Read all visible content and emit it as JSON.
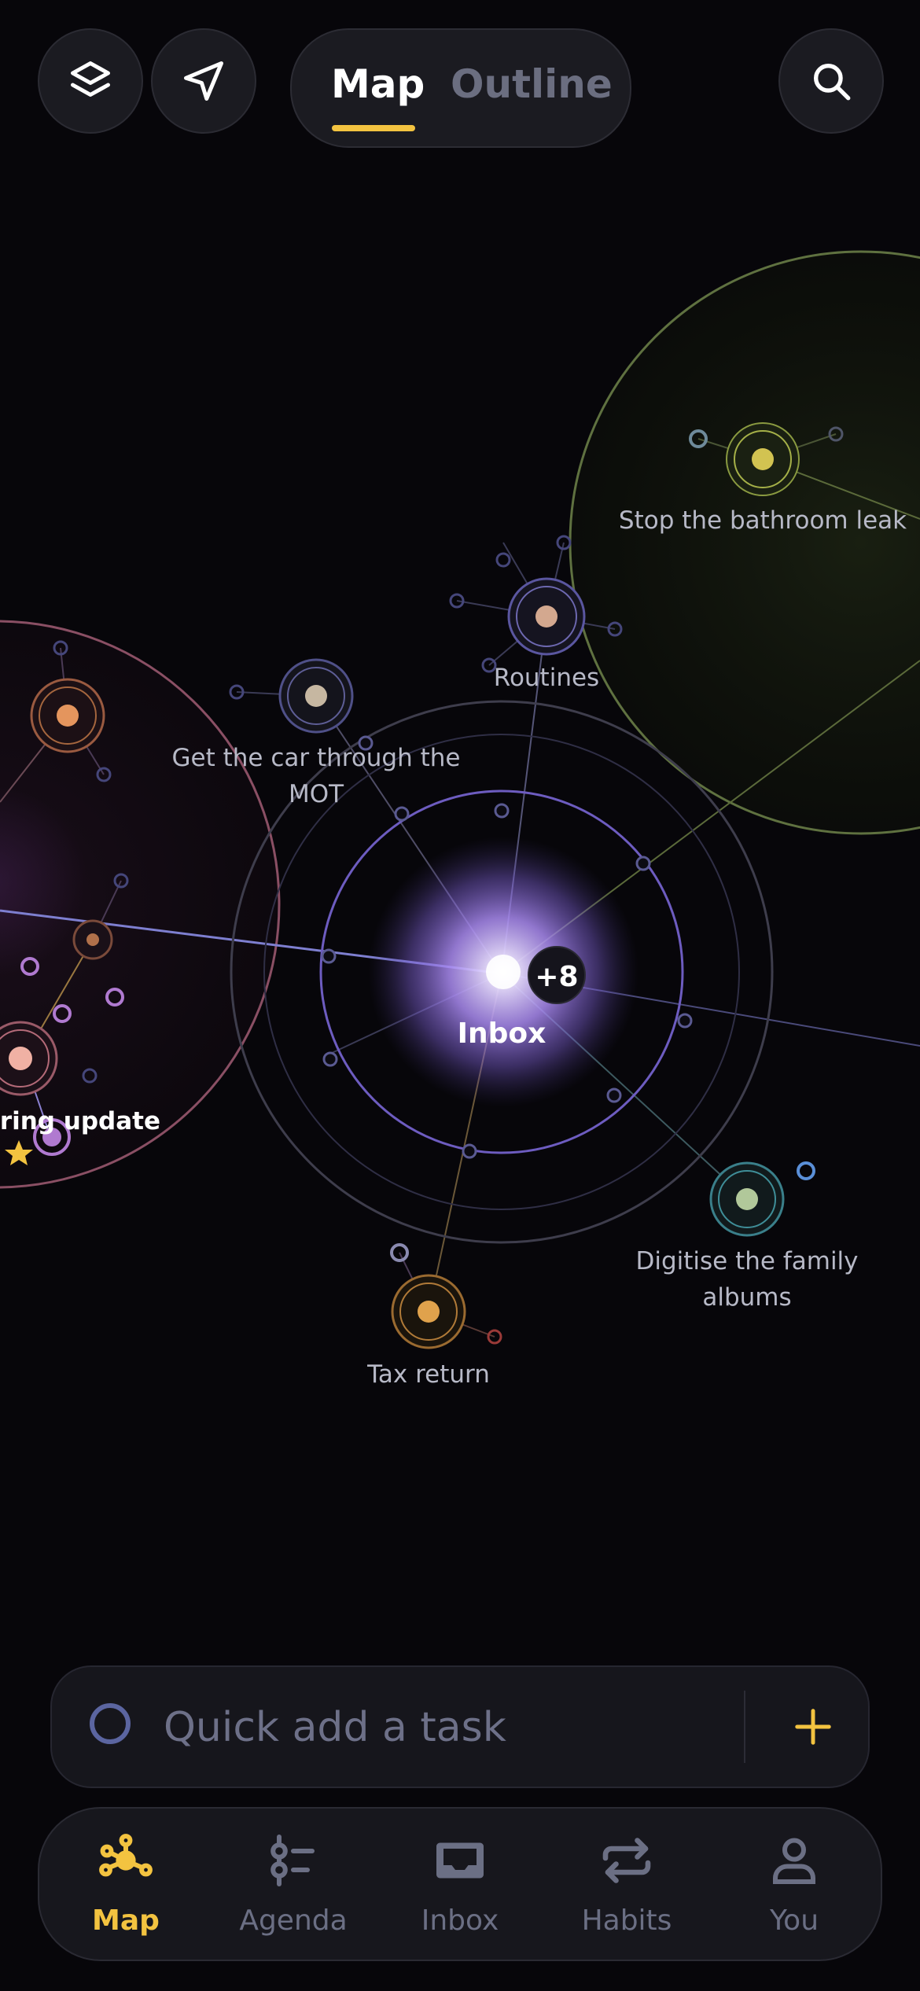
{
  "header": {
    "tabs": [
      {
        "label": "Map",
        "active": true
      },
      {
        "label": "Outline",
        "active": false
      }
    ],
    "buttons": [
      "layers-icon",
      "navigate-icon",
      "search-icon"
    ]
  },
  "map": {
    "hub": {
      "label": "Inbox",
      "badge": "+8"
    },
    "nodes": [
      {
        "label": "Stop the bathroom leak",
        "color": "#d2c351"
      },
      {
        "label": "Routines",
        "color": "#d3a88f"
      },
      {
        "label": "Get the car through the",
        "label2": "MOT",
        "color": "#c6b7a1"
      },
      {
        "label": "pring update",
        "color": "#f0b1a4"
      },
      {
        "label": "Digitise the family",
        "label2": "albums",
        "color": "#b1c89a"
      },
      {
        "label": "Tax return",
        "color": "#e0a24c"
      }
    ],
    "colors": {
      "accent": "#f3c340",
      "hub": "#a88af5",
      "green_zone": "#6d8048",
      "pink_zone": "#9e5b6f"
    }
  },
  "quick_add": {
    "placeholder": "Quick add a task",
    "value": ""
  },
  "nav": {
    "items": [
      {
        "label": "Map",
        "icon": "map-icon",
        "active": true
      },
      {
        "label": "Agenda",
        "icon": "agenda-icon",
        "active": false
      },
      {
        "label": "Inbox",
        "icon": "inbox-icon",
        "active": false
      },
      {
        "label": "Habits",
        "icon": "habits-icon",
        "active": false
      },
      {
        "label": "You",
        "icon": "profile-icon",
        "active": false
      }
    ]
  }
}
